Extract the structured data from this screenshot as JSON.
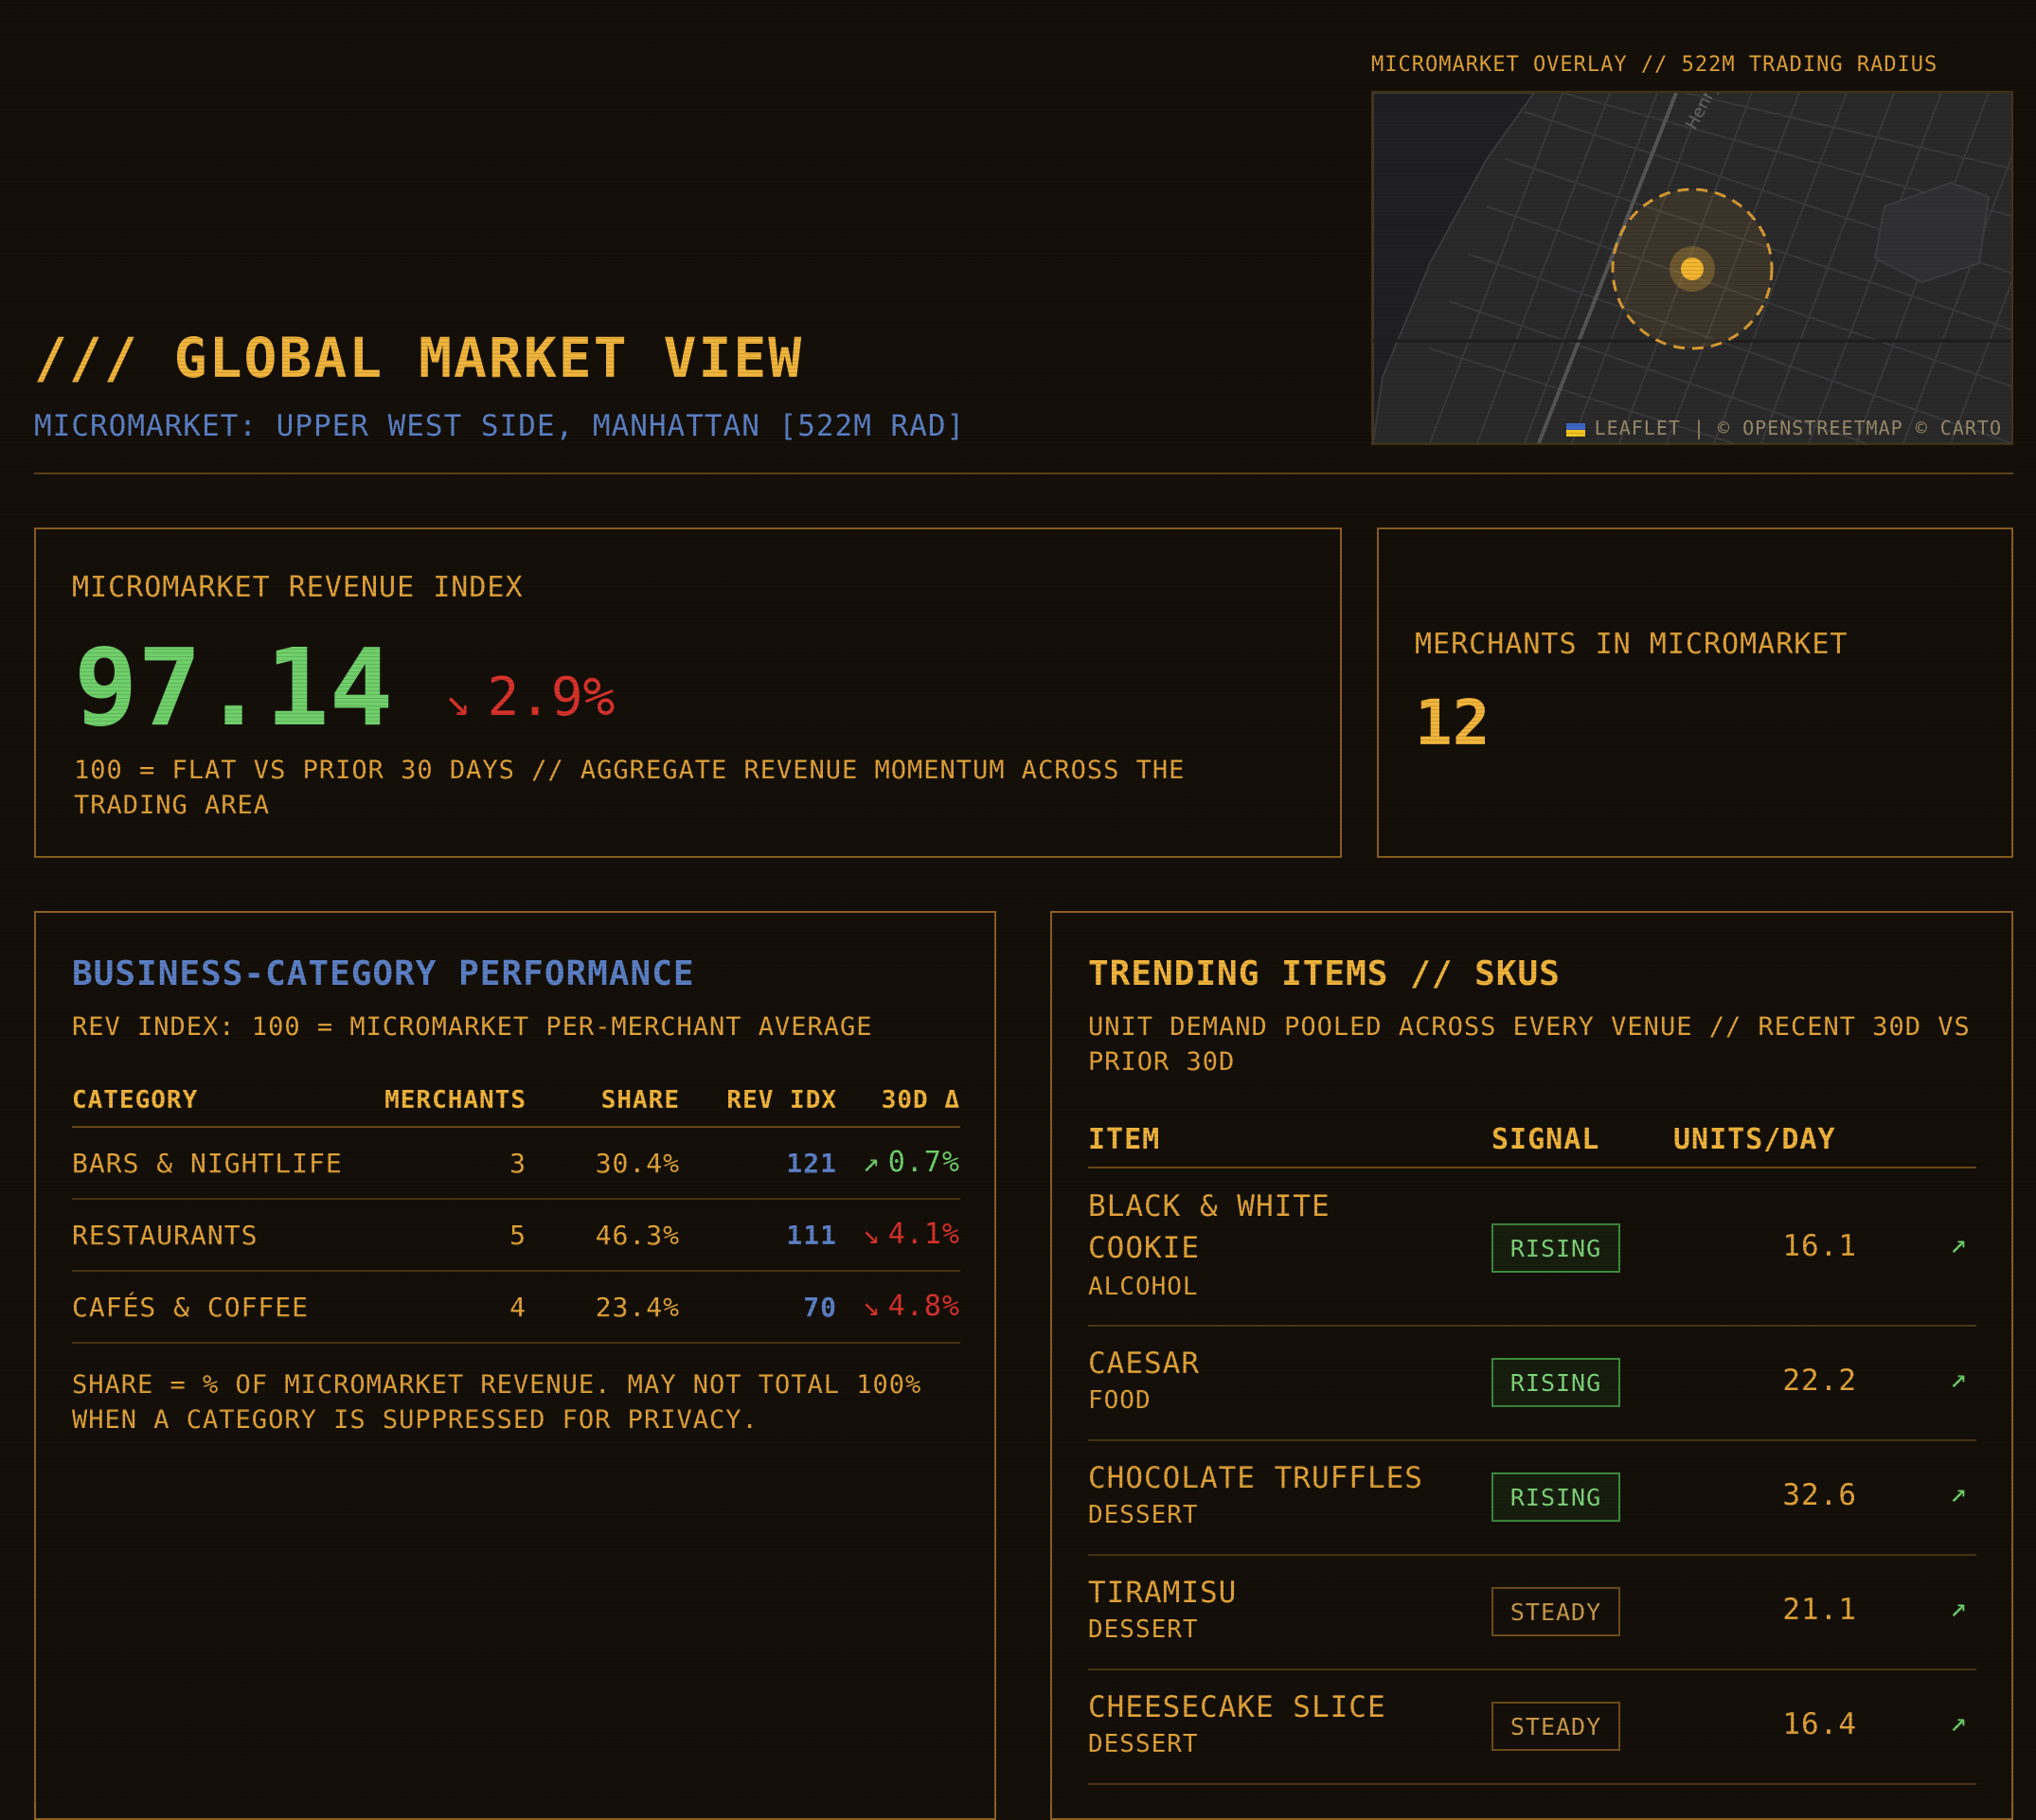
{
  "header": {
    "title": "/// GLOBAL MARKET VIEW",
    "subtitle": "MICROMARKET: UPPER WEST SIDE, MANHATTAN [522M RAD]"
  },
  "map": {
    "label": "MICROMARKET OVERLAY // 522M TRADING RADIUS",
    "attribution": "LEAFLET | © OPENSTREETMAP © CARTO",
    "street_label": "Henry"
  },
  "revenue_index": {
    "label": "MICROMARKET REVENUE INDEX",
    "value": "97.14",
    "delta_icon": "↘",
    "delta": "2.9%",
    "note": "100 = FLAT VS PRIOR 30 DAYS // AGGREGATE REVENUE MOMENTUM ACROSS THE TRADING AREA"
  },
  "merchants": {
    "label": "MERCHANTS IN MICROMARKET",
    "count": "12"
  },
  "categories": {
    "title": "BUSINESS-CATEGORY PERFORMANCE",
    "subtitle": "REV INDEX: 100 = MICROMARKET PER-MERCHANT AVERAGE",
    "columns": {
      "category": "CATEGORY",
      "merchants": "MERCHANTS",
      "share": "SHARE",
      "rev_idx": "REV IDX",
      "delta": "30D Δ"
    },
    "rows": [
      {
        "name": "BARS & NIGHTLIFE",
        "merchants": "3",
        "share": "30.4%",
        "rev_idx": "121",
        "delta_icon": "↗",
        "delta": "0.7%",
        "direction": "up"
      },
      {
        "name": "RESTAURANTS",
        "merchants": "5",
        "share": "46.3%",
        "rev_idx": "111",
        "delta_icon": "↘",
        "delta": "4.1%",
        "direction": "down"
      },
      {
        "name": "CAFÉS & COFFEE",
        "merchants": "4",
        "share": "23.4%",
        "rev_idx": "70",
        "delta_icon": "↘",
        "delta": "4.8%",
        "direction": "down"
      }
    ],
    "footnote": "SHARE = % OF MICROMARKET REVENUE. MAY NOT TOTAL 100% WHEN A CATEGORY IS SUPPRESSED FOR PRIVACY."
  },
  "trending": {
    "title": "TRENDING ITEMS // SKUS",
    "subtitle": "UNIT DEMAND POOLED ACROSS EVERY VENUE // RECENT 30D VS PRIOR 30D",
    "columns": {
      "item": "ITEM",
      "signal": "SIGNAL",
      "units": "UNITS/DAY"
    },
    "items": [
      {
        "name_line1": "BLACK & WHITE",
        "name_line2": "COOKIE",
        "category": "ALCOHOL",
        "signal": "RISING",
        "units": "16.1",
        "trend_icon": "↗"
      },
      {
        "name_line1": "CAESAR",
        "category": "FOOD",
        "signal": "RISING",
        "units": "22.2",
        "trend_icon": "↗"
      },
      {
        "name_line1": "CHOCOLATE TRUFFLES",
        "category": "DESSERT",
        "signal": "RISING",
        "units": "32.6",
        "trend_icon": "↗"
      },
      {
        "name_line1": "TIRAMISU",
        "category": "DESSERT",
        "signal": "STEADY",
        "units": "21.1",
        "trend_icon": "↗"
      },
      {
        "name_line1": "CHEESECAKE SLICE",
        "category": "DESSERT",
        "signal": "STEADY",
        "units": "16.4",
        "trend_icon": "↗"
      }
    ]
  },
  "colors": {
    "background": "#140f08",
    "amber": "#e0a238",
    "blue": "#5b7fc4",
    "green": "#6fcf6a",
    "red": "#d8322b",
    "border": "#8c5f1e"
  },
  "icons": {
    "delta_down": "arrow-down-right-icon",
    "delta_up": "arrow-up-right-icon",
    "map_marker": "location-dot-icon"
  }
}
